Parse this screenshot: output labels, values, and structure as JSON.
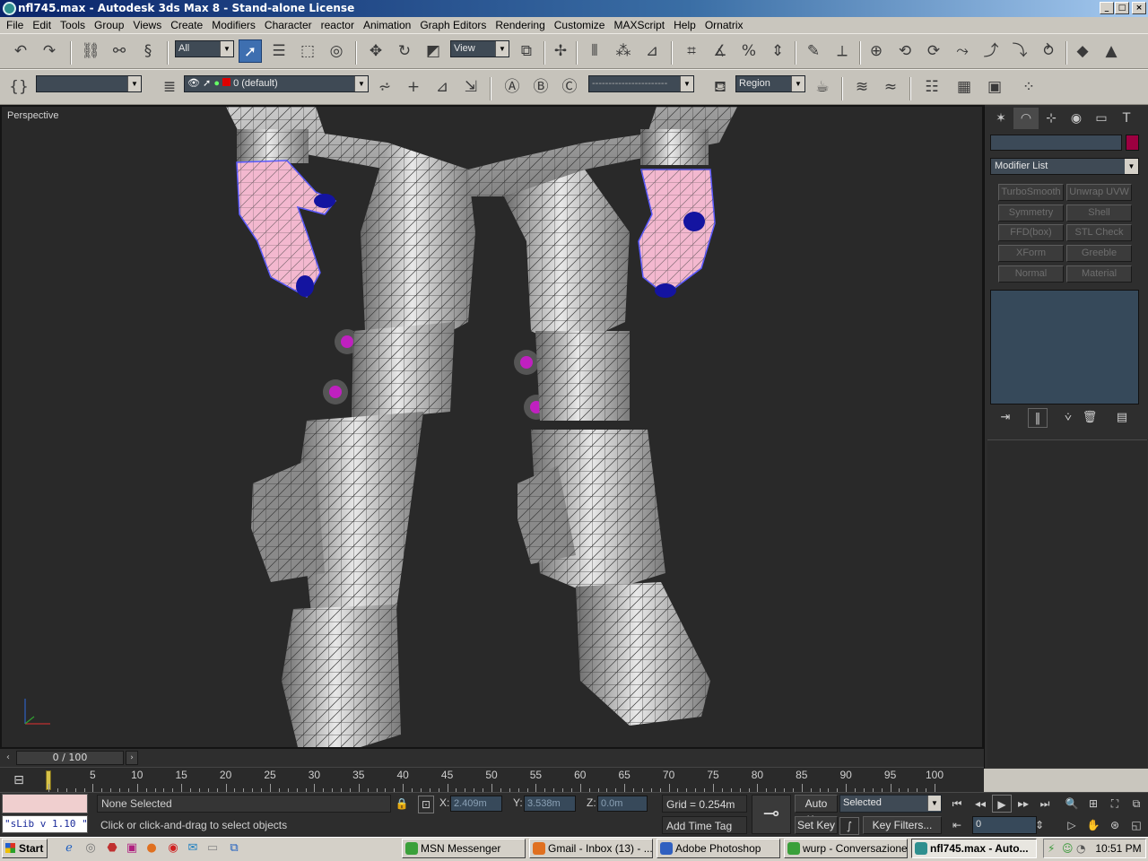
{
  "window": {
    "title": "nfl745.max - Autodesk 3ds Max 8  - Stand-alone License",
    "controls": [
      "_",
      "□",
      "×"
    ]
  },
  "menu": [
    "File",
    "Edit",
    "Tools",
    "Group",
    "Views",
    "Create",
    "Modifiers",
    "Character",
    "reactor",
    "Animation",
    "Graph Editors",
    "Rendering",
    "Customize",
    "MAXScript",
    "Help",
    "Ornatrix"
  ],
  "toolbar": {
    "selection_filter": "All",
    "reference_coord": "View",
    "layer": "0 (default)",
    "named_selection": "",
    "render_region": "Region"
  },
  "viewport": {
    "label": "Perspective"
  },
  "command_panel": {
    "name_value": "",
    "color": "#9c0040",
    "modifier_list": "Modifier List",
    "modifier_buttons": [
      "TurboSmooth",
      "Unwrap UVW",
      "Symmetry",
      "Shell",
      "FFD(box)",
      "STL Check",
      "XForm",
      "Greeble",
      "Normal",
      "Material"
    ]
  },
  "time_slider": {
    "position": "0 / 100"
  },
  "track_bar": {
    "ticks": [
      "5",
      "10",
      "15",
      "20",
      "25",
      "30",
      "35",
      "40",
      "45",
      "50",
      "55",
      "60",
      "65",
      "70",
      "75",
      "80",
      "85",
      "90",
      "95",
      "100"
    ]
  },
  "status": {
    "selection": "None Selected",
    "prompt": "Click or click-and-drag to select objects",
    "maxscript": "\"sLib v 1.10 \"",
    "x_label": "X:",
    "x_value": "2.409m",
    "y_label": "Y:",
    "y_value": "3.538m",
    "z_label": "Z:",
    "z_value": "0.0m",
    "grid": "Grid = 0.254m",
    "time_tag": "Add Time Tag",
    "auto_key": "Auto Key",
    "set_key": "Set Key",
    "key_mode": "Selected",
    "key_filters": "Key Filters...",
    "frame": "0"
  },
  "taskbar": {
    "start": "Start",
    "tasks": [
      {
        "label": "MSN Messenger",
        "color": "#3aa03a"
      },
      {
        "label": "Gmail - Inbox (13) - ...",
        "color": "#e07020"
      },
      {
        "label": "Adobe Photoshop",
        "color": "#3060c0"
      },
      {
        "label": "wurp - Conversazione",
        "color": "#3aa03a"
      },
      {
        "label": "nfl745.max - Auto...",
        "color": "#2f8f8f"
      }
    ],
    "clock": "10:51 PM"
  }
}
